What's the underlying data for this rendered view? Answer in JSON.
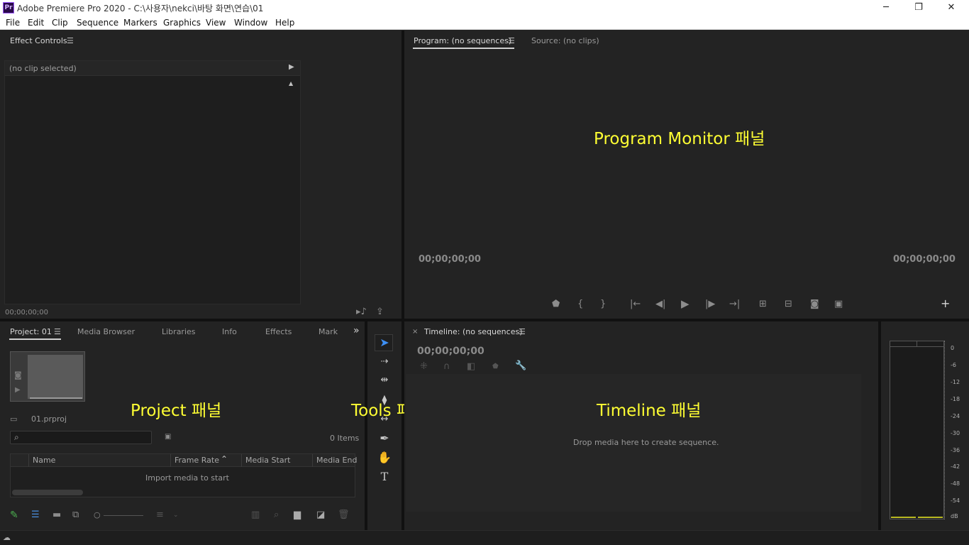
{
  "window": {
    "title": "Adobe Premiere Pro 2020 - C:\\사용자\\nekci\\바탕 화면\\연습\\01",
    "app_icon_text": "Pr",
    "minimize": "─",
    "restore": "❐",
    "close": "✕"
  },
  "menu": [
    "File",
    "Edit",
    "Clip",
    "Sequence",
    "Markers",
    "Graphics",
    "View",
    "Window",
    "Help"
  ],
  "effect_controls": {
    "tab": "Effect Controls",
    "clip_row": "(no clip selected)",
    "timecode": "00;00;00;00"
  },
  "monitor": {
    "program_tab": "Program: (no sequences)",
    "source_tab": "Source: (no clips)",
    "overlay_label": "Program Monitor 패널",
    "tc_left": "00;00;00;00",
    "tc_right": "00;00;00;00"
  },
  "project": {
    "tabs": [
      "Project: 01",
      "Media Browser",
      "Libraries",
      "Info",
      "Effects",
      "Mark"
    ],
    "overflow": "»",
    "overlay_label": "Project 패널",
    "file_name": "01.prproj",
    "item_count": "0 Items",
    "columns": [
      "Name",
      "Frame Rate",
      "Media Start",
      "Media End"
    ],
    "empty_text": "Import media to start"
  },
  "tools": {
    "overlay_label": "Tools 패널"
  },
  "timeline": {
    "tab": "Timeline: (no sequences)",
    "close": "×",
    "timecode": "00;00;00;00",
    "overlay_label": "Timeline 패널",
    "drop_text": "Drop media here to create sequence."
  },
  "audio_meter": {
    "ticks": [
      "0",
      "-6",
      "-12",
      "-18",
      "-24",
      "-30",
      "-36",
      "-42",
      "-48",
      "-54",
      "dB"
    ]
  }
}
